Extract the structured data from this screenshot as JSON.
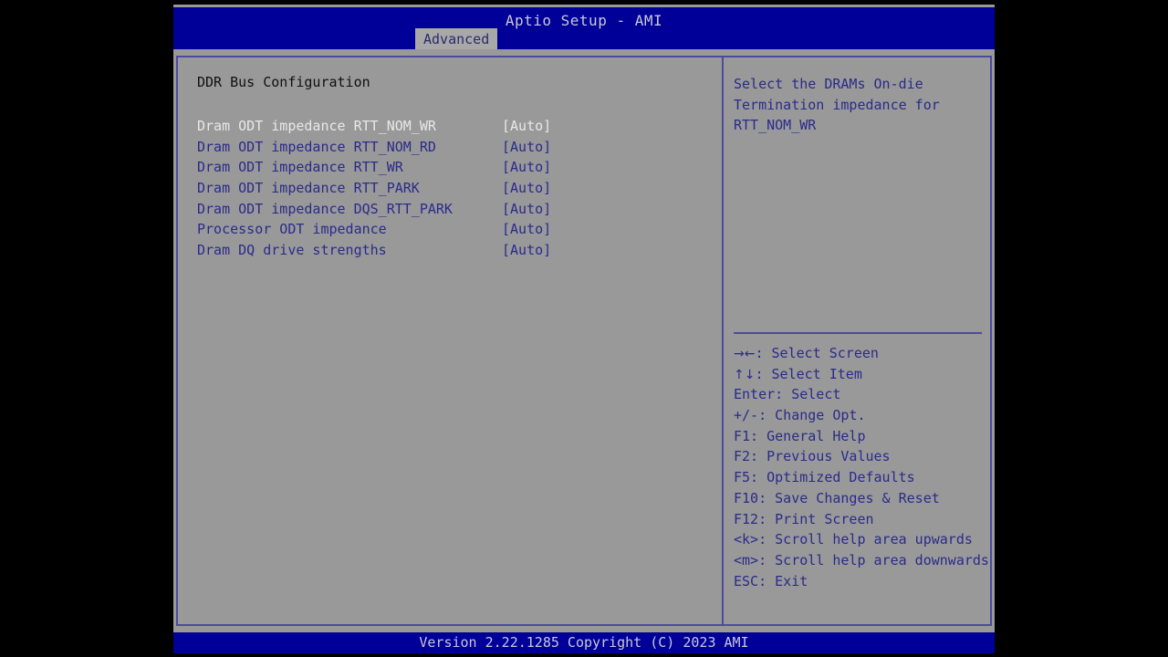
{
  "window": {
    "title": "Aptio Setup - AMI",
    "active_tab": "Advanced",
    "tabs": [
      "Advanced"
    ]
  },
  "colors": {
    "title_bar_blue": "#000099",
    "panel_gray": "#999999",
    "border_blue": "#4b4b9e",
    "text_blue": "#2a2a8c",
    "text_selected": "#e8e8e8",
    "heading_dark": "#101010",
    "footer_text": "#c8c8d8"
  },
  "main": {
    "section_title": "DDR Bus Configuration",
    "options": [
      {
        "label": "Dram ODT impedance RTT_NOM_WR",
        "value": "[Auto]",
        "selected": true
      },
      {
        "label": "Dram ODT impedance RTT_NOM_RD",
        "value": "[Auto]",
        "selected": false
      },
      {
        "label": "Dram ODT impedance RTT_WR",
        "value": "[Auto]",
        "selected": false
      },
      {
        "label": "Dram ODT impedance RTT_PARK",
        "value": "[Auto]",
        "selected": false
      },
      {
        "label": "Dram ODT impedance DQS_RTT_PARK",
        "value": "[Auto]",
        "selected": false
      },
      {
        "label": "Processor ODT impedance",
        "value": "[Auto]",
        "selected": false
      },
      {
        "label": "Dram DQ drive strengths",
        "value": "[Auto]",
        "selected": false
      }
    ]
  },
  "help": {
    "description": "Select the DRAMs On-die Termination impedance for RTT_NOM_WR",
    "keys": [
      {
        "glyph": "→←",
        "text": ": Select Screen"
      },
      {
        "glyph": "↑↓",
        "text": ": Select Item"
      },
      {
        "glyph": "",
        "text": "Enter: Select"
      },
      {
        "glyph": "",
        "text": "+/-: Change Opt."
      },
      {
        "glyph": "",
        "text": "F1: General Help"
      },
      {
        "glyph": "",
        "text": "F2: Previous Values"
      },
      {
        "glyph": "",
        "text": "F5: Optimized Defaults"
      },
      {
        "glyph": "",
        "text": "F10: Save Changes & Reset"
      },
      {
        "glyph": "",
        "text": "F12: Print Screen"
      },
      {
        "glyph": "",
        "text": "<k>: Scroll help area upwards"
      },
      {
        "glyph": "",
        "text": "<m>: Scroll help area downwards"
      },
      {
        "glyph": "",
        "text": "ESC: Exit"
      }
    ]
  },
  "footer": {
    "version_text": "Version 2.22.1285 Copyright (C) 2023 AMI"
  }
}
